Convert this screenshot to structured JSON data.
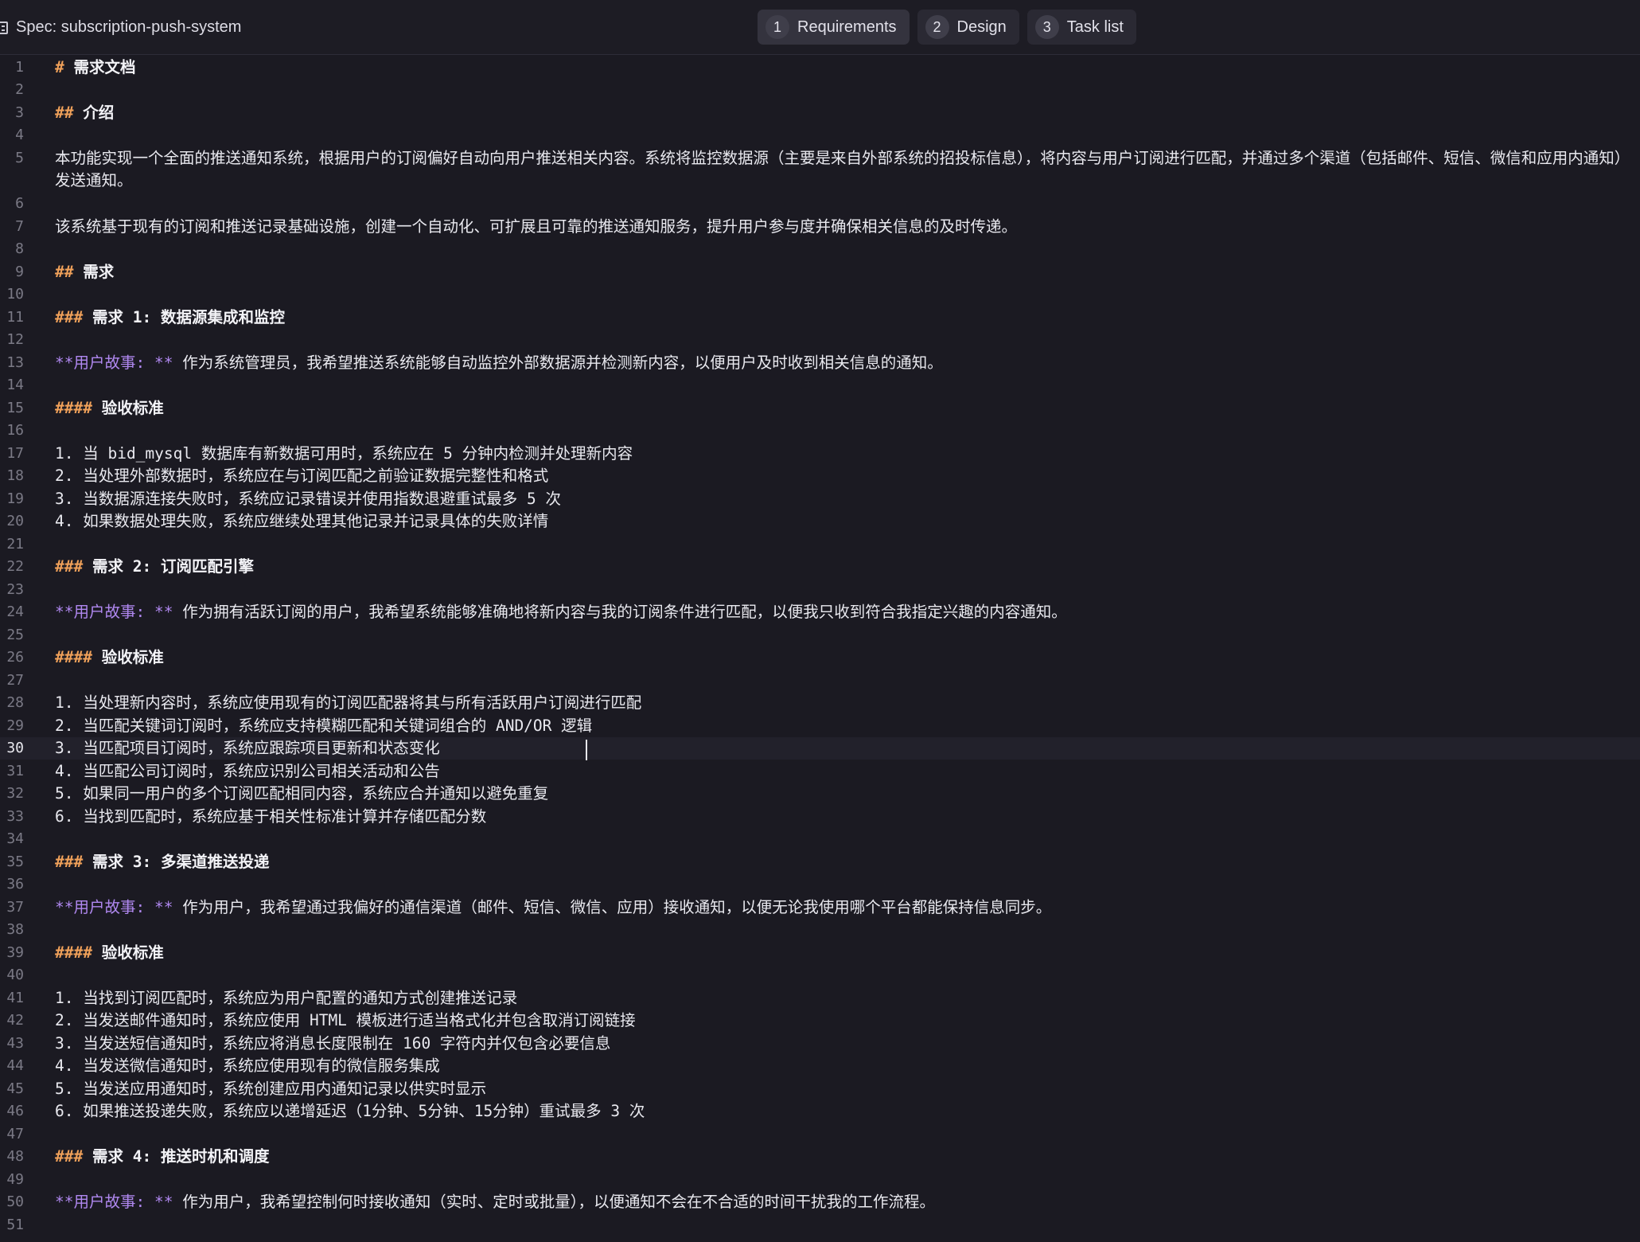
{
  "header": {
    "title": "Spec: subscription-push-system",
    "tabs": [
      {
        "num": "1",
        "label": "Requirements"
      },
      {
        "num": "2",
        "label": "Design"
      },
      {
        "num": "3",
        "label": "Task list"
      }
    ]
  },
  "editor": {
    "line_numbers": [
      "1",
      "2",
      "3",
      "4",
      "5",
      "6",
      "7",
      "8",
      "9",
      "10",
      "11",
      "12",
      "13",
      "14",
      "15",
      "16",
      "17",
      "18",
      "19",
      "20",
      "21",
      "22",
      "23",
      "24",
      "25",
      "26",
      "27",
      "28",
      "29",
      "30",
      "31",
      "32",
      "33",
      "34",
      "35",
      "36",
      "37",
      "38",
      "39",
      "40",
      "41",
      "42",
      "43",
      "44",
      "45",
      "46",
      "47",
      "48",
      "49",
      "50",
      "51"
    ],
    "h1_marker": "#",
    "h2_marker": "##",
    "h3_marker": "###",
    "h4_marker": "####",
    "story_label": "**用户故事: **",
    "l1": "需求文档",
    "l3": "介绍",
    "l5": "本功能实现一个全面的推送通知系统，根据用户的订阅偏好自动向用户推送相关内容。系统将监控数据源（主要是来自外部系统的招投标信息），将内容与用户订阅进行匹配，并通过多个渠道（包括邮件、短信、微信和应用内通知）发送通知。",
    "l7": "该系统基于现有的订阅和推送记录基础设施，创建一个自动化、可扩展且可靠的推送通知服务，提升用户参与度并确保相关信息的及时传递。",
    "l9": "需求",
    "l11": "需求 1: 数据源集成和监控",
    "l13": " 作为系统管理员，我希望推送系统能够自动监控外部数据源并检测新内容，以便用户及时收到相关信息的通知。",
    "l15": "验收标准",
    "l17": "1. 当 bid_mysql 数据库有新数据可用时，系统应在 5 分钟内检测并处理新内容",
    "l18": "2. 当处理外部数据时，系统应在与订阅匹配之前验证数据完整性和格式",
    "l19": "3. 当数据源连接失败时，系统应记录错误并使用指数退避重试最多 5 次",
    "l20": "4. 如果数据处理失败，系统应继续处理其他记录并记录具体的失败详情",
    "l22": "需求 2: 订阅匹配引擎",
    "l24": " 作为拥有活跃订阅的用户，我希望系统能够准确地将新内容与我的订阅条件进行匹配，以便我只收到符合我指定兴趣的内容通知。",
    "l26": "验收标准",
    "l28": "1. 当处理新内容时，系统应使用现有的订阅匹配器将其与所有活跃用户订阅进行匹配",
    "l29": "2. 当匹配关键词订阅时，系统应支持模糊匹配和关键词组合的 AND/OR 逻辑",
    "l30": "3. 当匹配项目订阅时，系统应跟踪项目更新和状态变化",
    "l31": "4. 当匹配公司订阅时，系统应识别公司相关活动和公告",
    "l32": "5. 如果同一用户的多个订阅匹配相同内容，系统应合并通知以避免重复",
    "l33": "6. 当找到匹配时，系统应基于相关性标准计算并存储匹配分数",
    "l35": "需求 3: 多渠道推送投递",
    "l37": " 作为用户，我希望通过我偏好的通信渠道（邮件、短信、微信、应用）接收通知，以便无论我使用哪个平台都能保持信息同步。",
    "l39": "验收标准",
    "l41": "1. 当找到订阅匹配时，系统应为用户配置的通知方式创建推送记录",
    "l42": "2. 当发送邮件通知时，系统应使用 HTML 模板进行适当格式化并包含取消订阅链接",
    "l43": "3. 当发送短信通知时，系统应将消息长度限制在 160 字符内并仅包含必要信息",
    "l44": "4. 当发送微信通知时，系统应使用现有的微信服务集成",
    "l45": "5. 当发送应用通知时，系统创建应用内通知记录以供实时显示",
    "l46": "6. 如果推送投递失败，系统应以递增延迟（1分钟、5分钟、15分钟）重试最多 3 次",
    "l48": "需求 4: 推送时机和调度",
    "l50": " 作为用户，我希望控制何时接收通知（实时、定时或批量），以便通知不会在不合适的时间干扰我的工作流程。"
  },
  "colors": {
    "background": "#1b1a22",
    "markdown_marker": "#f0a15a",
    "story_label": "#b088f0",
    "text": "#e9e9ef",
    "line_number": "#7b7a86"
  },
  "icons": [
    "spec-document-icon"
  ]
}
